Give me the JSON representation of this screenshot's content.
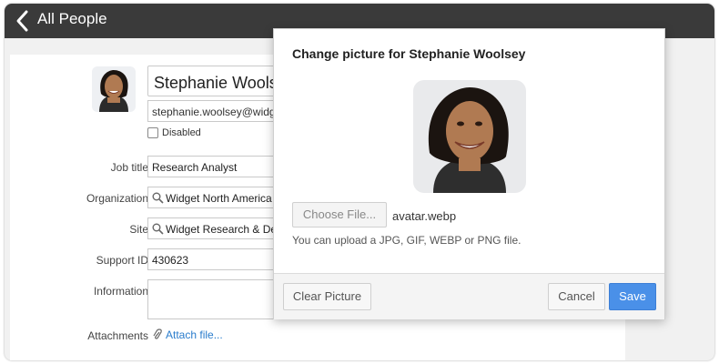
{
  "header": {
    "title": "All People"
  },
  "profile": {
    "name": "Stephanie Woolsey",
    "email": "stephanie.woolsey@widget",
    "disabled_label": "Disabled",
    "fields": [
      {
        "label": "Job title",
        "value": "Research Analyst"
      },
      {
        "label": "Organization",
        "value": "Widget North America"
      },
      {
        "label": "Site",
        "value": "Widget Research & Dev"
      },
      {
        "label": "Support ID",
        "value": "430623"
      },
      {
        "label": "Information",
        "value": ""
      }
    ],
    "attachments_label": "Attachments",
    "attach_link": "Attach file..."
  },
  "dialog": {
    "title": "Change picture for Stephanie Woolsey",
    "choose_button": "Choose File...",
    "file_name": "avatar.webp",
    "hint": "You can upload a JPG, GIF, WEBP or PNG file.",
    "clear_button": "Clear Picture",
    "cancel_button": "Cancel",
    "save_button": "Save"
  },
  "colors": {
    "accent": "#4a90e8",
    "link": "#2a7ccc",
    "header": "#3a3a3a"
  },
  "icons": [
    "back-icon",
    "search-icon",
    "paperclip-icon",
    "avatar-photo"
  ]
}
